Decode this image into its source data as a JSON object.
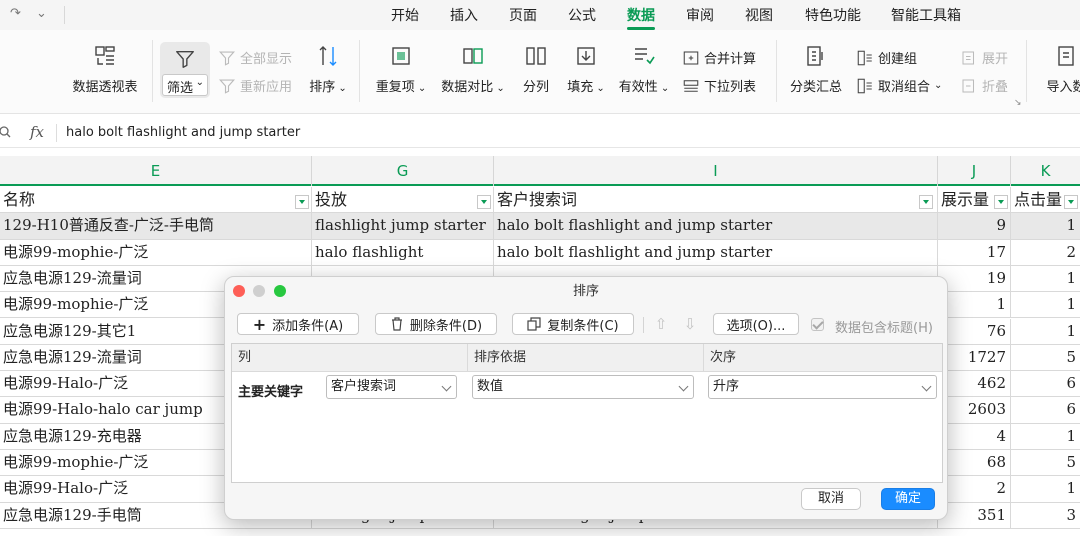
{
  "menubar": {
    "tabs": [
      "开始",
      "插入",
      "页面",
      "公式",
      "数据",
      "审阅",
      "视图",
      "特色功能",
      "智能工具箱"
    ],
    "active_tab": "数据"
  },
  "ribbon": {
    "pivot": "数据透视表",
    "filter": "筛选",
    "show_all": "全部显示",
    "reapply": "重新应用",
    "sort": "排序",
    "duplicates": "重复项",
    "compare": "数据对比",
    "split": "分列",
    "fill": "填充",
    "validity": "有效性",
    "merge_calc": "合并计算",
    "dropdown_list": "下拉列表",
    "subtotal": "分类汇总",
    "create_group": "创建组",
    "ungroup": "取消组合",
    "expand": "展开",
    "collapse": "折叠",
    "import": "导入数"
  },
  "formula_bar": {
    "fx": "fx",
    "content": "halo bolt flashlight and jump starter"
  },
  "columns": [
    "E",
    "G",
    "I",
    "J",
    "K"
  ],
  "header_row": {
    "e": "名称",
    "g": "投放",
    "i": "客户搜索词",
    "j": "展示量",
    "k": "点击量"
  },
  "rows": [
    {
      "e": "129-H10普通反查-广泛-手电筒",
      "g": "flashlight jump starter",
      "i": "halo bolt flashlight and jump starter",
      "j": "9",
      "k": "1"
    },
    {
      "e": "电源99-mophie-广泛",
      "g": "halo flashlight",
      "i": "halo bolt flashlight and jump starter",
      "j": "17",
      "k": "2"
    },
    {
      "e": "应急电源129-流量词",
      "g": "",
      "i": "",
      "j": "19",
      "k": "1"
    },
    {
      "e": "电源99-mophie-广泛",
      "g": "",
      "i": "",
      "j": "1",
      "k": "1"
    },
    {
      "e": "应急电源129-其它1",
      "g": "",
      "i": "",
      "j": "76",
      "k": "1"
    },
    {
      "e": "应急电源129-流量词",
      "g": "",
      "i": "",
      "j": "1727",
      "k": "5"
    },
    {
      "e": "电源99-Halo-广泛",
      "g": "",
      "i": "",
      "j": "462",
      "k": "6"
    },
    {
      "e": "电源99-Halo-halo car jump",
      "g": "",
      "i": "",
      "j": "2603",
      "k": "6"
    },
    {
      "e": "应急电源129-充电器",
      "g": "",
      "i": "",
      "j": "4",
      "k": "1"
    },
    {
      "e": "电源99-mophie-广泛",
      "g": "",
      "i": "",
      "j": "68",
      "k": "5"
    },
    {
      "e": "电源99-Halo-广泛",
      "g": "",
      "i": "",
      "j": "2",
      "k": "1"
    },
    {
      "e": "应急电源129-手电筒",
      "g": "flashlight jump starter",
      "i": "halo flashlight jump starter",
      "j": "351",
      "k": "3"
    }
  ],
  "dialog": {
    "title": "排序",
    "add_condition": "添加条件(A)",
    "delete_condition": "删除条件(D)",
    "copy_condition": "复制条件(C)",
    "options": "选项(O)...",
    "has_header": "数据包含标题(H)",
    "col_header": "列",
    "basis_header": "排序依据",
    "order_header": "次序",
    "primary_key": "主要关键字",
    "column_value": "客户搜索词",
    "basis_value": "数值",
    "order_value": "升序",
    "cancel": "取消",
    "ok": "确定"
  }
}
